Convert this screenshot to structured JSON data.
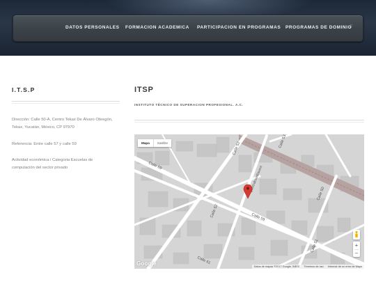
{
  "nav": {
    "items": [
      {
        "label": "DATOS PERSONALES"
      },
      {
        "label": "FORMACION ACADEMICA"
      },
      {
        "label": "PARTICIPACION EN PROGRAMAS"
      },
      {
        "label": "PROGRAMAS DE DOMINIO"
      }
    ],
    "separator": "//"
  },
  "sidebar": {
    "title": "I.T.S.P",
    "address": "Dirección: Calle 50-A, Centro Tekax De Álvaro Obregón, Tekax, Yucatán, México, CP 97970",
    "reference": "Referencia: Entre calle 57 y calle 59",
    "activity": "Actividad económica / Categoria Escuelas de computación del sector privado"
  },
  "main": {
    "title": "ITSP",
    "subtitle": "INSTITUTO TÉCNICO DE SUPERACION PROFESIONAL. A.C."
  },
  "map": {
    "type_active": "Mapa",
    "type_inactive": "Satélite",
    "streets": [
      "Calle 52",
      "Calle 53",
      "Calle 59",
      "Calle 50",
      "Calle 59",
      "Calle 52",
      "Calle 61",
      "Calle 51",
      "Quetzalcoatl/aveni"
    ],
    "zoom_in": "+",
    "zoom_out": "−",
    "google": "Google",
    "footer": [
      "Datos de mapas ©2017 Google, INEGI",
      "Términos de uso",
      "Informar de un error de Maps"
    ],
    "colors": {
      "marker": "#d93a30",
      "rail": "#b8a3a3",
      "road": "#ffffff",
      "block": "#c4c4c4"
    }
  }
}
